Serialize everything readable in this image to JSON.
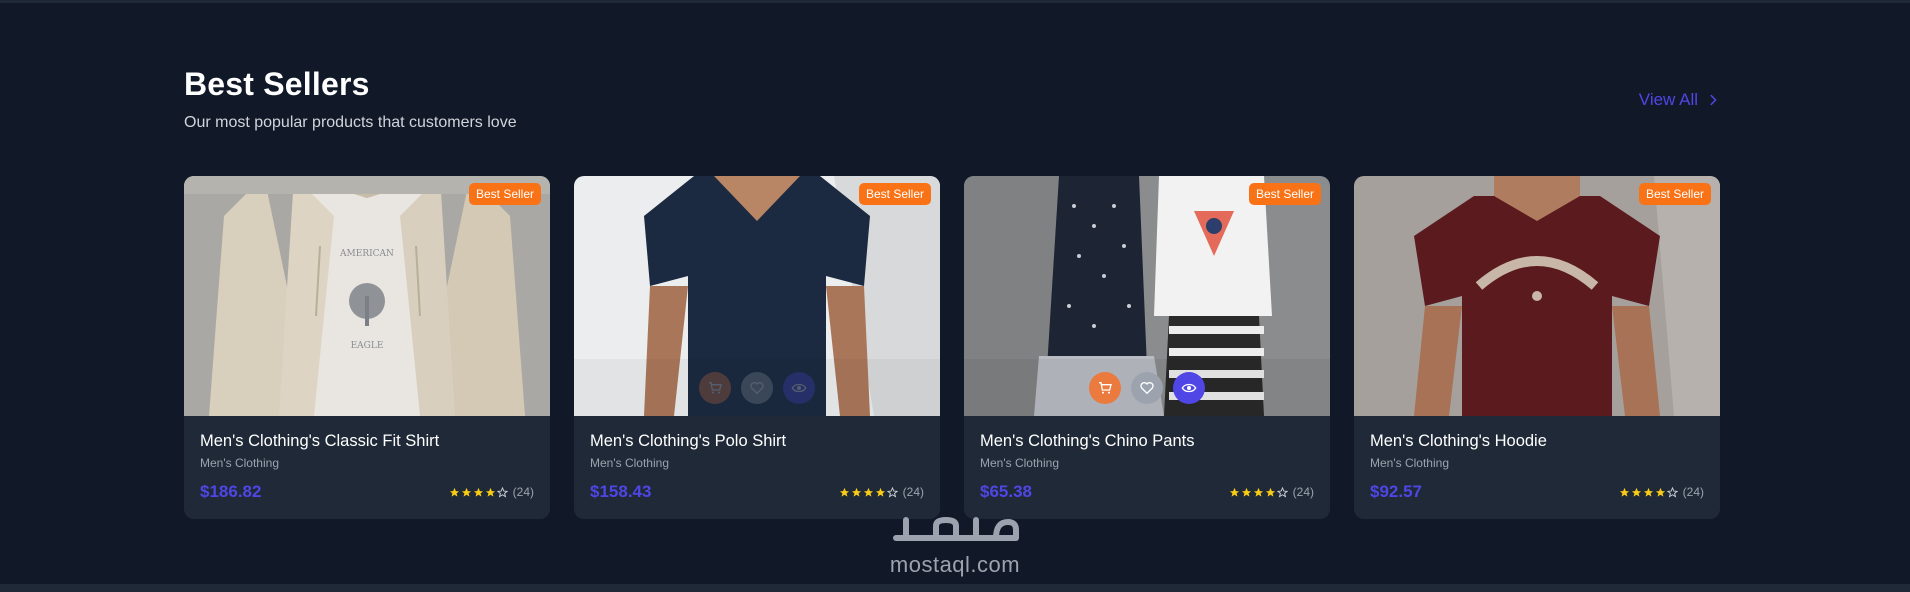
{
  "section": {
    "title": "Best Sellers",
    "subtitle": "Our most popular products that customers love",
    "view_all": "View All"
  },
  "products": [
    {
      "name": "Men's Clothing's Classic Fit Shirt",
      "category": "Men's Clothing",
      "price": "$186.82",
      "rating": 4,
      "reviews": "(24)",
      "badge": "Best Seller",
      "image": "hoodie-beige-photo"
    },
    {
      "name": "Men's Clothing's Polo Shirt",
      "category": "Men's Clothing",
      "price": "$158.43",
      "rating": 4,
      "reviews": "(24)",
      "badge": "Best Seller",
      "image": "navy-tshirt-photo"
    },
    {
      "name": "Men's Clothing's Chino Pants",
      "category": "Men's Clothing",
      "price": "$65.38",
      "rating": 4,
      "reviews": "(24)",
      "badge": "Best Seller",
      "image": "kids-clothing-photo"
    },
    {
      "name": "Men's Clothing's Hoodie",
      "category": "Men's Clothing",
      "price": "$92.57",
      "rating": 4,
      "reviews": "(24)",
      "badge": "Best Seller",
      "image": "maroon-tshirt-photo"
    }
  ],
  "watermark": {
    "text": "mostaql.com"
  },
  "colors": {
    "accent": "#4f46e5",
    "badge": "#f97316",
    "star": "#facc15",
    "background": "#111827",
    "card": "#1f2937"
  }
}
